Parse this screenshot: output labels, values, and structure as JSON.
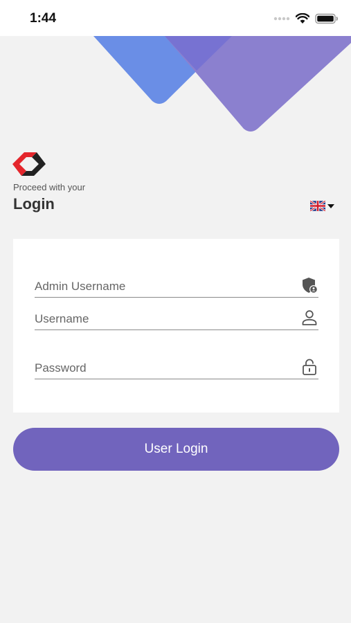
{
  "status_bar": {
    "time": "1:44",
    "icons": [
      "signal-icon",
      "wifi-icon",
      "battery-icon"
    ]
  },
  "header": {
    "subtitle": "Proceed with your",
    "title": "Login"
  },
  "language": {
    "selected_icon": "uk-flag-icon"
  },
  "form": {
    "admin_username_placeholder": "Admin Username",
    "username_placeholder": "Username",
    "password_placeholder": "Password"
  },
  "actions": {
    "login_label": "User Login"
  },
  "colors": {
    "accent": "#7164bd",
    "decor_blue": "#6a8ee6",
    "decor_purple": "#8b80cf",
    "logo_red": "#e4262c",
    "logo_dark": "#222222"
  }
}
